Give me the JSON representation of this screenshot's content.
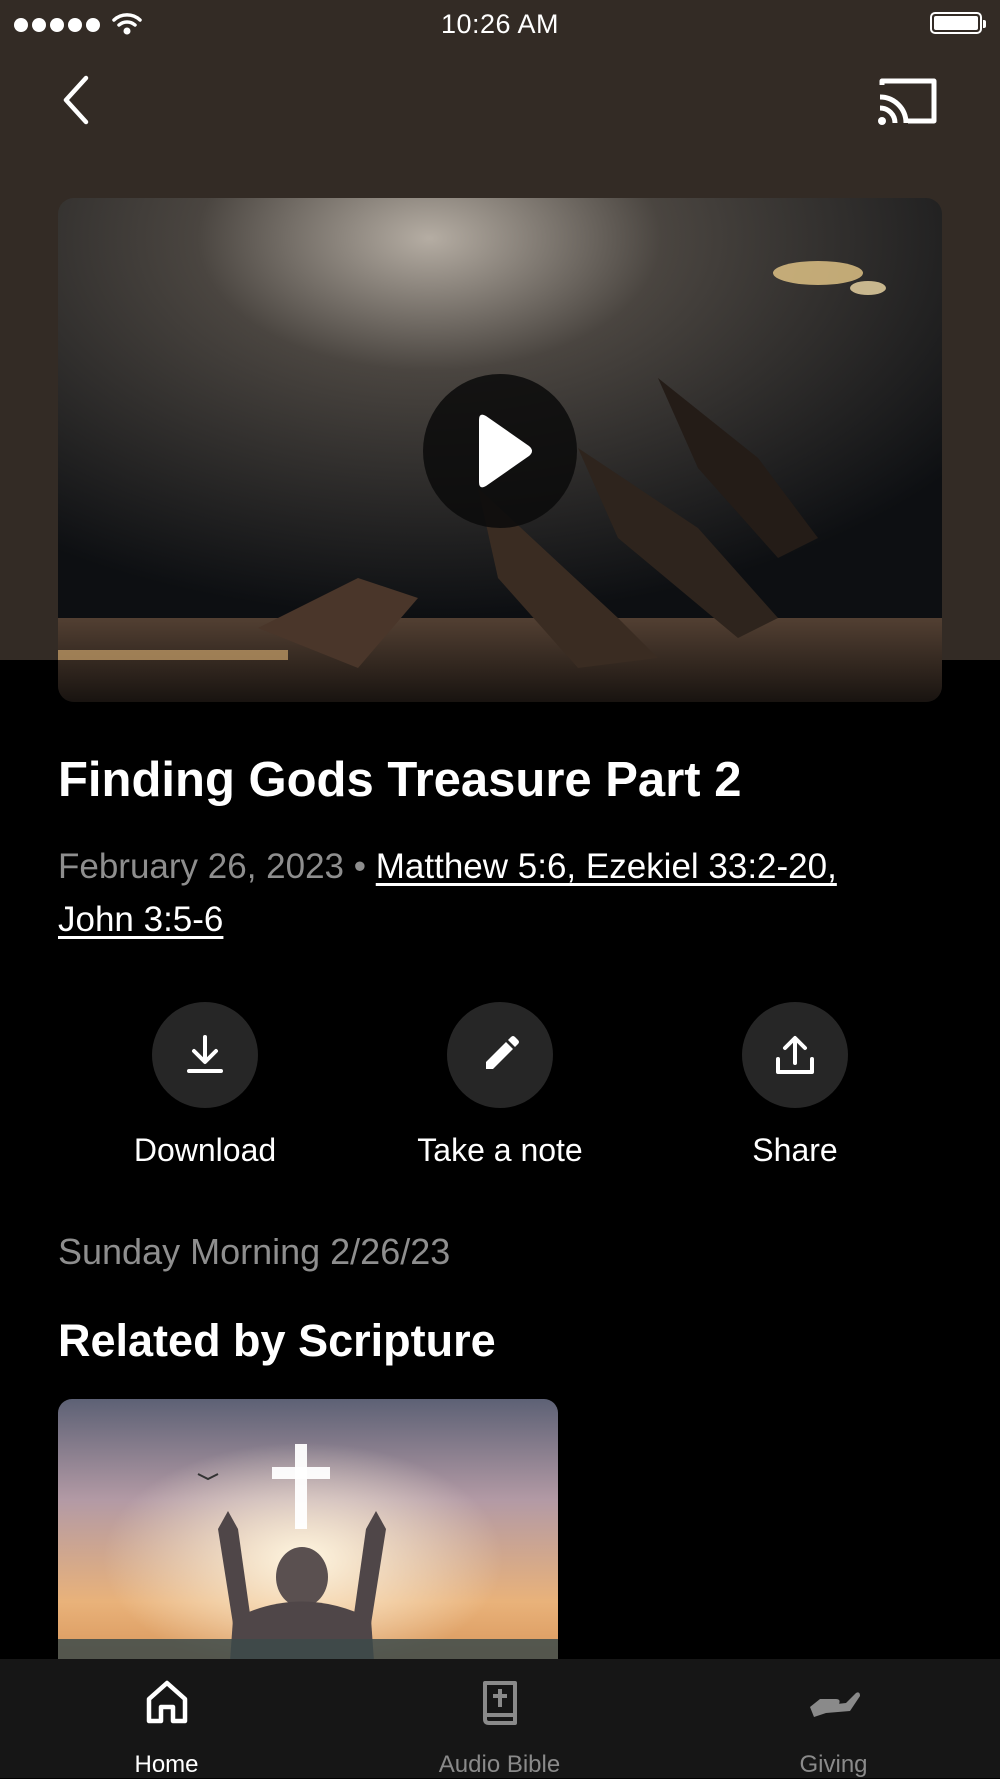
{
  "status_bar": {
    "time": "10:26 AM"
  },
  "header": {
    "back_icon": "chevron-left-icon",
    "cast_icon": "cast-icon",
    "background_color": "#332b25"
  },
  "video": {
    "play_icon": "play-icon"
  },
  "sermon": {
    "title": "Finding Gods Treasure Part 2",
    "date": "February 26, 2023",
    "separator": "•",
    "scripture": "Matthew 5:6, Ezekiel 33:2-20, John 3:5-6",
    "subtitle": "Sunday Morning 2/26/23"
  },
  "actions": [
    {
      "label": "Download",
      "icon": "download-icon"
    },
    {
      "label": "Take a note",
      "icon": "pencil-icon"
    },
    {
      "label": "Share",
      "icon": "share-icon"
    }
  ],
  "related": {
    "heading": "Related by Scripture"
  },
  "tab_bar": {
    "tabs": [
      {
        "label": "Home",
        "icon": "home-icon",
        "active": true
      },
      {
        "label": "Audio Bible",
        "icon": "bible-icon",
        "active": false
      },
      {
        "label": "Giving",
        "icon": "giving-hand-icon",
        "active": false
      }
    ],
    "active_color": "#ffffff",
    "inactive_color": "#8a8a8a"
  }
}
